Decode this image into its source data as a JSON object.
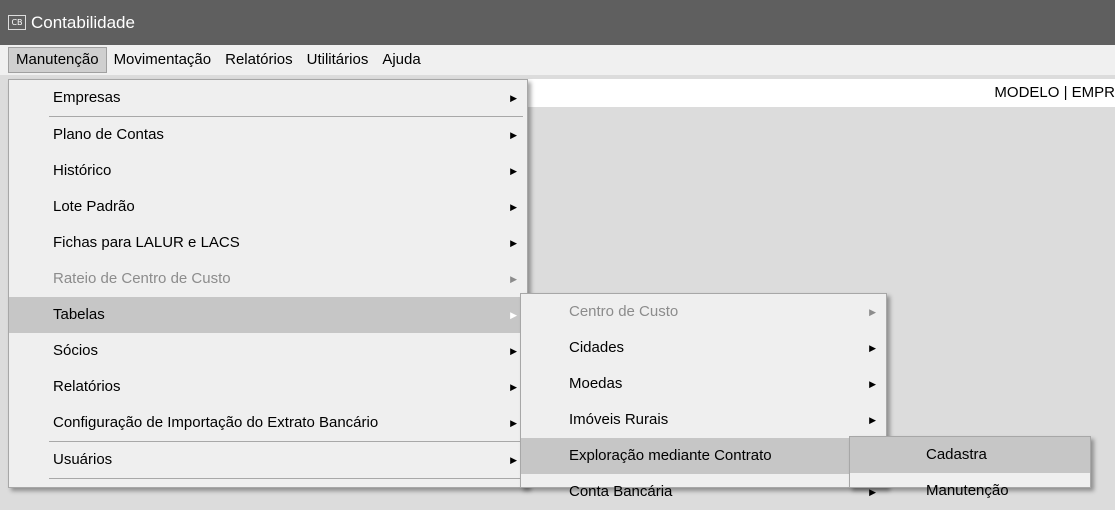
{
  "window": {
    "title": "Contabilidade",
    "icon_label": "CB"
  },
  "menubar": {
    "items": [
      "Manutenção",
      "Movimentação",
      "Relatórios",
      "Utilitários",
      "Ajuda"
    ]
  },
  "header_strip": {
    "text": "MODELO | EMPR"
  },
  "menu_manutencao": {
    "items": [
      "Empresas",
      "Plano de Contas",
      "Histórico",
      "Lote Padrão",
      "Fichas para LALUR e LACS",
      "Rateio de Centro de Custo",
      "Tabelas",
      "Sócios",
      "Relatórios",
      "Configuração de Importação do Extrato Bancário",
      "Usuários"
    ]
  },
  "menu_tabelas": {
    "items": [
      "Centro de Custo",
      "Cidades",
      "Moedas",
      "Imóveis Rurais",
      "Exploração mediante Contrato",
      "Conta Bancária"
    ]
  },
  "menu_exploracao": {
    "items": [
      "Cadastra",
      "Manutenção"
    ]
  },
  "icons": {
    "submenu_arrow": "▶"
  },
  "colors": {
    "titlebar": "#5f5f5f",
    "menu_bg": "#efefef",
    "highlight": "#c6c6c6",
    "disabled_text": "#8c8c8c"
  }
}
